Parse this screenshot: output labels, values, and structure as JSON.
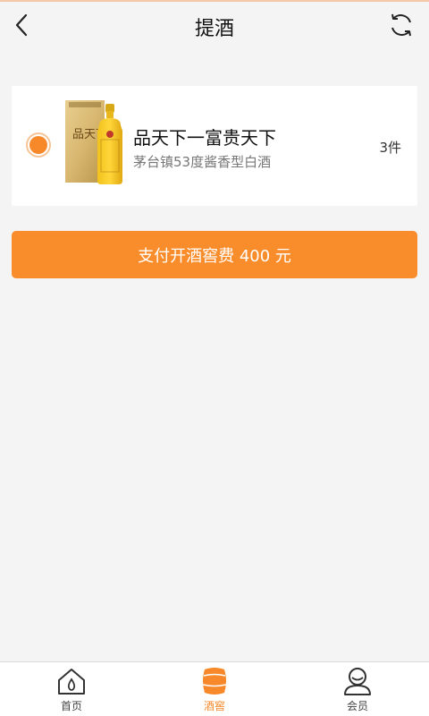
{
  "header": {
    "title": "提酒",
    "back_icon": "back-arrow-icon",
    "refresh_icon": "refresh-icon"
  },
  "item": {
    "name": "品天下一富贵天下",
    "subtitle": "茅台镇53度酱香型白酒",
    "quantity": "3件",
    "selected": true,
    "product_image_text": "品天下"
  },
  "pay_button": {
    "label": "支付开酒窖费 400 元"
  },
  "tabbar": {
    "tabs": [
      {
        "label": "首页",
        "icon": "home-icon",
        "active": false
      },
      {
        "label": "酒窖",
        "icon": "wine-cellar-icon",
        "active": true
      },
      {
        "label": "会员",
        "icon": "member-icon",
        "active": false
      }
    ]
  },
  "colors": {
    "accent": "#f7892a",
    "button": "#f98c2b",
    "background": "#f4f4f4"
  }
}
